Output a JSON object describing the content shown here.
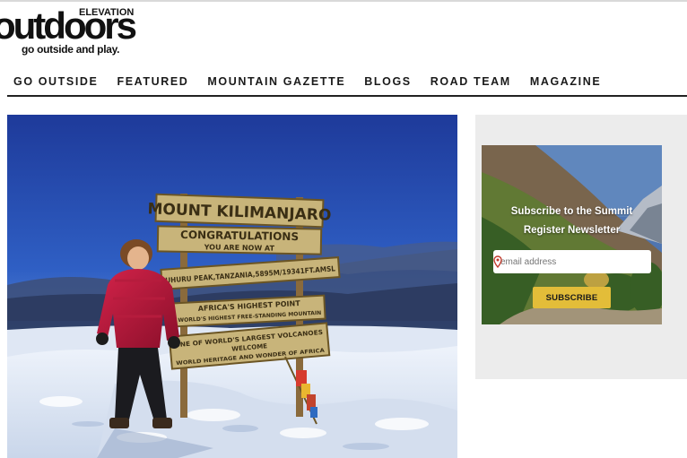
{
  "logo": {
    "elevation": "ELEVATION",
    "wordmark": "outdoors",
    "tagline": "go outside and play."
  },
  "nav": {
    "items": [
      "GO OUTSIDE",
      "FEATURED",
      "MOUNTAIN GAZETTE",
      "BLOGS",
      "ROAD TEAM",
      "MAGAZINE"
    ]
  },
  "hero": {
    "sign_lines": [
      "MOUNT KILIMANJARO",
      "CONGRATULATIONS",
      "YOU ARE NOW AT",
      "UHURU PEAK,TANZANIA,5895M/19341FT.AMSL",
      "AFRICA'S HIGHEST POINT",
      "WORLD'S HIGHEST FREE-STANDING MOUNTAIN",
      "ONE OF WORLD'S LARGEST VOLCANOES",
      "WELCOME",
      "WORLD HERITAGE AND WONDER OF AFRICA"
    ]
  },
  "sidebar": {
    "promo_title_line1": "Subscribe to the Summit",
    "promo_title_line2": "Register Newsletter",
    "email_placeholder": "email address",
    "subscribe_label": "SUBSCRIBE"
  },
  "colors": {
    "accent_button": "#e3bd39",
    "sidebar_bg": "#ececec",
    "nav_text": "#1a1a1a"
  }
}
